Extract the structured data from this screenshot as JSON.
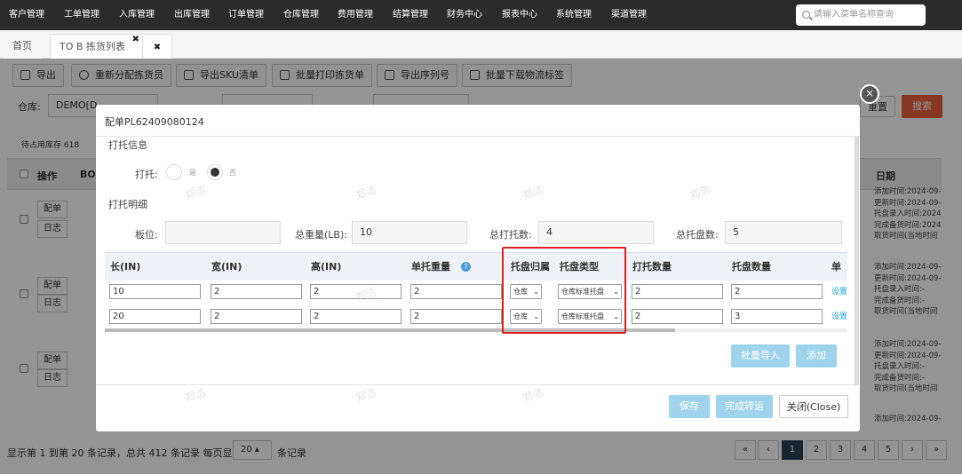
{
  "top_menu": [
    "客户管理",
    "工单管理",
    "入库管理",
    "出库管理",
    "订单管理",
    "仓库管理",
    "费用管理",
    "结算管理",
    "财务中心",
    "报表中心",
    "系统管理",
    "渠道管理"
  ],
  "search": {
    "placeholder": "请输入菜单名称查询"
  },
  "tabs": {
    "home": "首页",
    "current": "TO B 拣货列表",
    "close_glyph": "✖",
    "x_glyph": "✖"
  },
  "toolbar": [
    "导出",
    "重新分配拣货员",
    "导出SKU清单",
    "批量打印拣货单",
    "导出序列号",
    "批量下载物流标签"
  ],
  "filters": {
    "warehouse_label": "仓库:",
    "warehouse_value": "DEMO[D",
    "reset": "重置",
    "search": "搜索"
  },
  "list": {
    "summary": "待占用库存 618",
    "col_op": "操作",
    "col_bo": "BO",
    "col_date": "日期",
    "row_btn_a": "配单",
    "row_btn_b": "日志",
    "date_lines_1": [
      "添加时间:2024-09-",
      "更新时间:2024-09-",
      "托盘录入时间:2024",
      "完成备货时间:2024",
      "取货时间(当地时间"
    ],
    "date_lines_2": [
      "添加时间:2024-09-",
      "更新时间:2024-09-",
      "托盘录入时间:-",
      "完成备货时间:-",
      "取货时间(当地时间"
    ],
    "date_lines_3": [
      "添加时间:2024-09-",
      "更新时间:2024-09-",
      "托盘录入时间:-",
      "完成备货时间:-",
      "取货时间(当地时间"
    ],
    "date_line_4": "添加时间:2024-09-"
  },
  "pager": {
    "summary": "显示第 1 到第 20 条记录，总共 412 条记录 每页显示",
    "page_size": "20 ▴",
    "suffix": "条记录",
    "pages": [
      "«",
      "‹",
      "1",
      "2",
      "3",
      "4",
      "5",
      "›",
      "»"
    ],
    "active_page": "1"
  },
  "modal": {
    "title": "配单PL62409080124",
    "section_pallet": "打托信息",
    "pallet_label": "打托:",
    "opt_yes": "是",
    "opt_no": "否",
    "section_detail": "打托明细",
    "position_label": "板位:",
    "position_value": "",
    "weight_label": "总重量(LB):",
    "weight_value": "10",
    "pallet_count_label": "总打托数:",
    "pallet_count_value": "4",
    "tray_count_label": "总托盘数:",
    "tray_count_value": "5",
    "columns": [
      "长(IN)",
      "宽(IN)",
      "高(IN)",
      "单托重量",
      "托盘归属",
      "托盘类型",
      "打托数量",
      "托盘数量",
      "单"
    ],
    "help_glyph": "?",
    "rows": [
      {
        "length": "10",
        "width": "2",
        "height": "2",
        "weight": "2",
        "owner": "仓库",
        "type": "仓库标准托盘",
        "pallets": "2",
        "trays": "2",
        "action": "设置"
      },
      {
        "length": "20",
        "width": "2",
        "height": "2",
        "weight": "2",
        "owner": "仓库",
        "type": "仓库标准托盘",
        "pallets": "2",
        "trays": "3",
        "action": "设置"
      }
    ],
    "bulk_import": "批量导入",
    "add": "添加",
    "save": "保存",
    "finish": "完成转运",
    "close": "关闭(Close)",
    "close_glyph": "×"
  },
  "watermark": "郑洁",
  "colors": {
    "primary": "#1ea0d8",
    "search_btn": "#e8603c",
    "highlight": "#e02020",
    "nav": "#2b2b2b"
  }
}
